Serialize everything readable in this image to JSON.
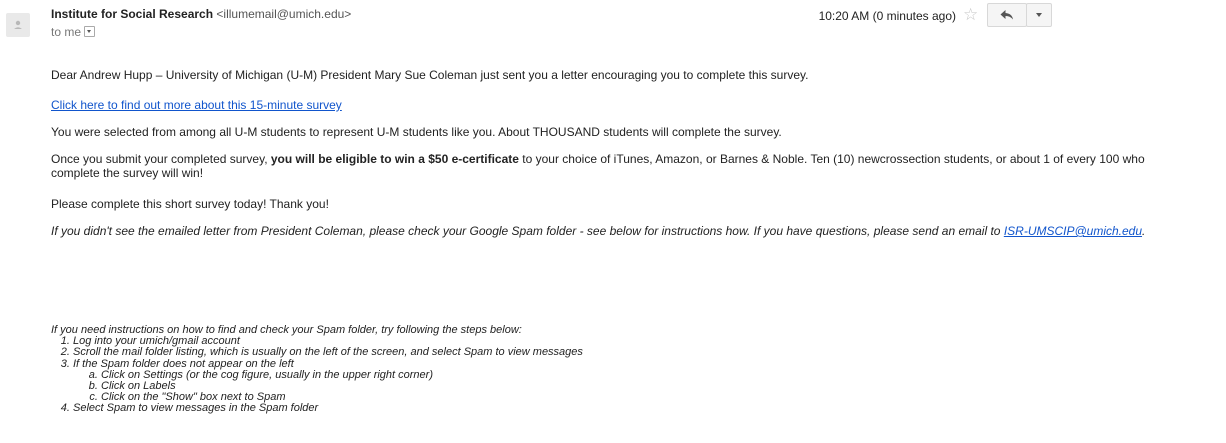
{
  "header": {
    "sender_name": "Institute for Social Research",
    "sender_email": "<illumemail@umich.edu>",
    "recipient": "to me",
    "timestamp": "10:20 AM (0 minutes ago)"
  },
  "icons": {
    "avatar": "person-icon",
    "star": "star-icon",
    "reply": "reply-icon",
    "more": "chevron-down-icon"
  },
  "body": {
    "p1": "Dear Andrew Hupp – University of Michigan (U-M) President Mary Sue Coleman just sent you a letter encouraging you to complete this survey.",
    "link": "Click here to find out more about this 15-minute survey",
    "p3": "You were selected from among all U-M students to represent U-M students like you. About THOUSAND students will complete the survey.",
    "p4_pre": "Once you submit your completed survey, ",
    "p4_bold": "you will be eligible to win a $50 e-certificate",
    "p4_post": " to your choice of iTunes, Amazon, or Barnes & Noble. Ten (10) newcrossection students, or about 1 of every 100 who complete the survey will win!",
    "p5": "Please complete this short survey today! Thank you!",
    "p6_pre": "If you didn't see the emailed letter from President Coleman, please check your Google Spam folder - see below for instructions how. If you have questions, please send an email to ",
    "p6_link": "ISR-UMSCIP@umich.edu",
    "p6_post": "."
  },
  "instructions": {
    "intro": "If you need instructions on how to find and check your Spam folder, try following the steps below:",
    "steps": [
      "Log into your umich/gmail account",
      "Scroll the mail folder listing, which is usually on the left of the screen, and select Spam to view messages",
      "If the Spam folder does not appear on the left",
      "Select Spam to view messages in the Spam folder"
    ],
    "substeps": [
      "Click on Settings (or the cog figure, usually in the upper right corner)",
      "Click on Labels",
      "Click on the \"Show\" box next to Spam"
    ]
  }
}
